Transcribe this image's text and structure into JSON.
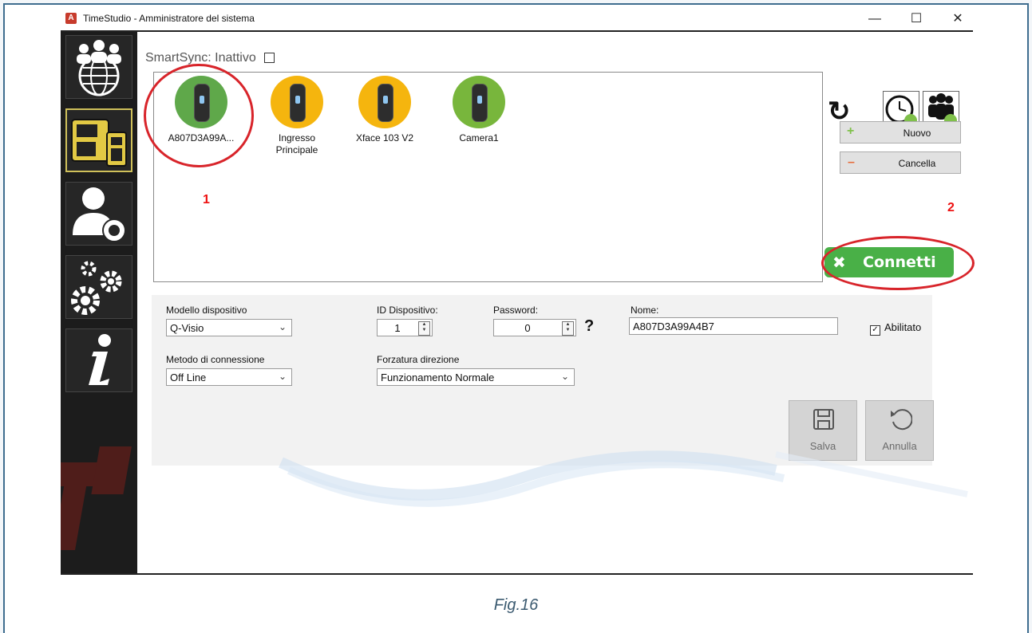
{
  "window": {
    "title": "TimeStudio - Amministratore del sistema",
    "minimize": "—",
    "maximize": "☐",
    "close": "✕"
  },
  "sidebar": {
    "items": [
      {
        "icon": "users-globe-icon"
      },
      {
        "icon": "terminal-devices-icon",
        "active": true
      },
      {
        "icon": "user-key-icon"
      },
      {
        "icon": "gears-icon"
      },
      {
        "icon": "info-icon"
      }
    ]
  },
  "smartsync": {
    "label": "SmartSync: Inattivo",
    "checked": false
  },
  "devices": [
    {
      "label": "A807D3A99A...",
      "color": "#5fa84a"
    },
    {
      "label": "Ingresso Principale",
      "color": "#f5b50e"
    },
    {
      "label": "Xface 103 V2",
      "color": "#f5b50e"
    },
    {
      "label": "Camera1",
      "color": "#78b63c"
    }
  ],
  "annotations": {
    "one": "1",
    "two": "2"
  },
  "toolbar": {
    "nuovo_label": "Nuovo",
    "cancella_label": "Cancella",
    "connetti_label": "Connetti"
  },
  "form": {
    "modello_label": "Modello dispositivo",
    "modello_value": "Q-Visio",
    "id_label": "ID Dispositivo:",
    "id_value": "1",
    "password_label": "Password:",
    "password_value": "0",
    "help": "?",
    "nome_label": "Nome:",
    "nome_value": "A807D3A99A4B7",
    "abilitato_label": "Abilitato",
    "abilitato_checked": true,
    "metodo_label": "Metodo di connessione",
    "metodo_value": "Off Line",
    "forzatura_label": "Forzatura direzione",
    "forzatura_value": "Funzionamento Normale",
    "salva_label": "Salva",
    "annulla_label": "Annulla"
  },
  "caption": "Fig.16",
  "colors": {
    "accent_green": "#49b047",
    "annotation_red": "#d8242a",
    "frame_blue": "#3f6d8f"
  }
}
